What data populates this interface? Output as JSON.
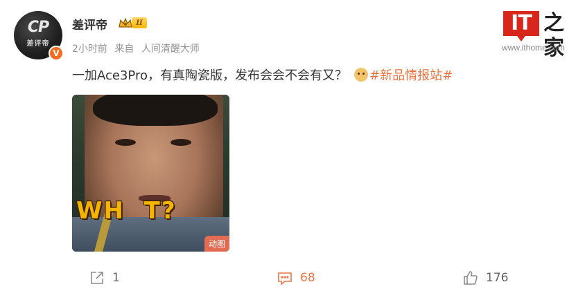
{
  "user": {
    "name": "差评帝",
    "avatar_text": "CP",
    "avatar_sub": "差评帝",
    "level": "II",
    "verified_mark": "V"
  },
  "post": {
    "time": "2小时前",
    "source_prefix": "来自",
    "source": "人间清醒大师",
    "text": "一加Ace3Pro，有真陶瓷版，发布会会不会有又？",
    "topic": "#新品情报站#",
    "media": {
      "overlay_text": "WH  T?",
      "badge": "动图"
    }
  },
  "watermark": {
    "logo_it": "IT",
    "logo_cn": "之家",
    "url": "www.ithome.com"
  },
  "actions": {
    "share_count": "1",
    "comment_count": "68",
    "like_count": "176"
  },
  "colors": {
    "accent": "#eb7340",
    "verified": "#f56b1f",
    "ithome_red": "#d9261c"
  }
}
